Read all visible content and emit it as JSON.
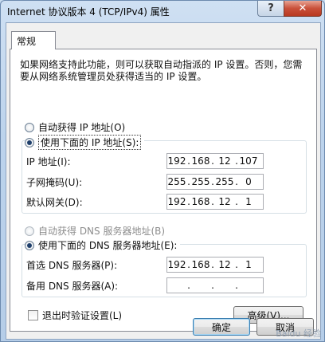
{
  "window": {
    "title": "Internet 协议版本 4 (TCP/IPv4) 属性",
    "help_label": "?",
    "close_label": "✕"
  },
  "tab": {
    "label": "常规"
  },
  "description": "如果网络支持此功能，则可以获取自动指派的 IP 设置。否则，您需要从网络系统管理员处获得适当的 IP 设置。",
  "ip_section": {
    "auto_label": "自动获得 IP 地址(O)",
    "manual_label": "使用下面的 IP 地址(S):",
    "selected": "manual",
    "fields": [
      {
        "label": "IP 地址(I):",
        "octets": [
          "192",
          "168",
          "12",
          "107"
        ]
      },
      {
        "label": "子网掩码(U):",
        "octets": [
          "255",
          "255",
          "255",
          "0"
        ]
      },
      {
        "label": "默认网关(D):",
        "octets": [
          "192",
          "168",
          "12",
          "1"
        ]
      }
    ]
  },
  "dns_section": {
    "auto_label": "自动获得 DNS 服务器地址(B)",
    "manual_label": "使用下面的 DNS 服务器地址(E):",
    "selected": "manual",
    "fields": [
      {
        "label": "首选 DNS 服务器(P):",
        "octets": [
          "192",
          "168",
          "12",
          "1"
        ]
      },
      {
        "label": "备用 DNS 服务器(A):",
        "octets": [
          "",
          "",
          "",
          ""
        ]
      }
    ]
  },
  "validate_label": "退出时验证设置(L)",
  "advanced_label": "高级(V)...",
  "ok_label": "确定",
  "cancel_label": "取消",
  "watermark": "Baidu 经验"
}
